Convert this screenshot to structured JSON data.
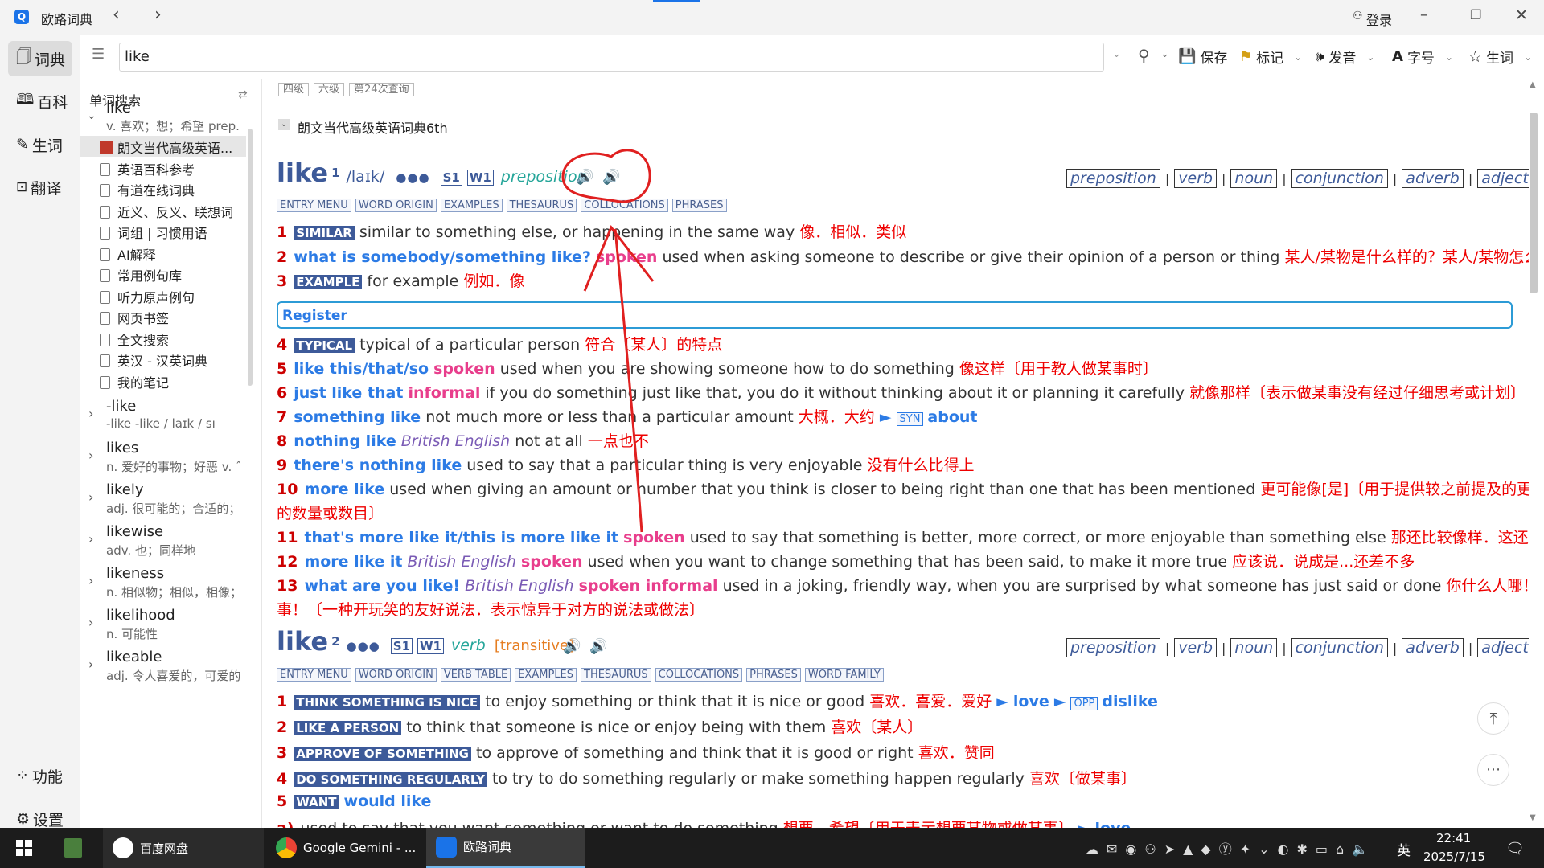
{
  "app": {
    "title": "欧路词典",
    "login": "登录"
  },
  "nav": [
    {
      "label": "词典"
    },
    {
      "label": "百科"
    },
    {
      "label": "生词"
    },
    {
      "label": "翻译"
    }
  ],
  "nav_bottom": [
    {
      "label": "功能"
    },
    {
      "label": "设置"
    }
  ],
  "search": {
    "value": "like"
  },
  "toolbar": {
    "save": "保存",
    "mark": "标记",
    "speak": "发音",
    "font": "字号",
    "vocab": "生词"
  },
  "panel": {
    "title": "单词搜索"
  },
  "wordlist": {
    "first": {
      "word": "like",
      "def": "v. 喜欢；想；希望 prep."
    },
    "dicts": [
      "朗文当代高级英语...",
      "英语百科参考",
      "有道在线词典",
      "近义、反义、联想词",
      "词组 | 习惯用语",
      "AI解释",
      "常用例句库",
      "听力原声例句",
      "网页书签",
      "全文搜索",
      "英汉 - 汉英词典",
      "我的笔记"
    ],
    "words": [
      {
        "word": "-like",
        "def": "-like -like / laɪk / sı"
      },
      {
        "word": "likes",
        "def": "n. 爱好的事物；好恶 v. ˆ"
      },
      {
        "word": "likely",
        "def": "adj. 很可能的；合适的；"
      },
      {
        "word": "likewise",
        "def": "adv. 也；同样地"
      },
      {
        "word": "likeness",
        "def": "n. 相似物；相似，相像；"
      },
      {
        "word": "likelihood",
        "def": "n. 可能性"
      },
      {
        "word": "likeable",
        "def": "adj. 令人喜爱的，可爱的"
      }
    ]
  },
  "entry": {
    "levels": [
      "四级",
      "六级",
      "第24次查询"
    ],
    "dict_name": "朗文当代高级英语词典6th",
    "hw1": {
      "word": "like",
      "sup": "1",
      "pron": "/laɪk/",
      "dots": "●●●",
      "s": "S1",
      "w": "W1",
      "pos": "preposition"
    },
    "pos_buttons": [
      "preposition",
      "verb",
      "noun",
      "conjunction",
      "adverb",
      "adjective"
    ],
    "sections1": [
      "ENTRY MENU",
      "WORD ORIGIN",
      "EXAMPLES",
      "THESAURUS",
      "COLLOCATIONS",
      "PHRASES"
    ],
    "senses1": [
      {
        "n": "1",
        "tag": "SIMILAR",
        "text": "similar to something else, or happening in the same way",
        "cn": "像．相似．类似"
      },
      {
        "n": "2",
        "kw": "what is somebody/something like?",
        "spk": "spoken",
        "text": "used when asking someone to describe or give their opinion of a person or thing",
        "cn": "某人/某物是什么样的？某人/某物怎么样？"
      },
      {
        "n": "3",
        "tag": "EXAMPLE",
        "text": "for example",
        "cn": "例如．像"
      }
    ],
    "register": "Register",
    "senses2": [
      {
        "n": "4",
        "tag": "TYPICAL",
        "text": "typical of a particular person",
        "cn": "符合〔某人〕的特点"
      },
      {
        "n": "5",
        "kw": "like this/that/so",
        "spk": "spoken",
        "text": "used when you are showing someone how to do something",
        "cn": "像这样〔用于教人做某事时〕"
      },
      {
        "n": "6",
        "kw": "just like that",
        "spk": "informal",
        "text": "if you do something just like that, you do it without thinking about it or planning it carefully",
        "cn": "就像那样〔表示做某事没有经过仔细思考或计划〕"
      },
      {
        "n": "7",
        "kw": "something like",
        "text": "not much more or less than a particular amount",
        "cn": "大概．大约",
        "syn": "SYN",
        "ref": "about"
      },
      {
        "n": "8",
        "kw": "nothing like",
        "var": "British English",
        "text": "not at all",
        "cn": "一点也不"
      },
      {
        "n": "9",
        "kw": "there's nothing like",
        "text": "used to say that a particular thing is very enjoyable",
        "cn": "没有什么比得上"
      },
      {
        "n": "10",
        "kw": "more like",
        "text": "used when giving an amount or number that you think is closer to being right than one that has been mentioned",
        "cn": "更可能像[是]〔用于提供较之前提及的更准确",
        "cn2": "的数量或数目〕"
      },
      {
        "n": "11",
        "kw": "that's more like it/this is more like it",
        "spk": "spoken",
        "text": "used to say that something is better, more correct, or more enjoyable than something else",
        "cn": "那还比较像样．这还差不多"
      },
      {
        "n": "12",
        "kw": "more like it",
        "var": "British English",
        "spk": "spoken",
        "text": "used when you want to change something that has been said, to make it more true",
        "cn": "应该说．说成是...还差不多"
      },
      {
        "n": "13",
        "kw": "what are you like!",
        "var": "British English",
        "spk": "spoken informal",
        "text": "used in a joking, friendly way, when you are surprised by what someone has just said or done",
        "cn": "你什么人哪！你怎么回",
        "cn2": "事！〔一种开玩笑的友好说法．表示惊异于对方的说法或做法〕"
      }
    ],
    "hw2": {
      "word": "like",
      "sup": "2",
      "dots": "●●●",
      "s": "S1",
      "w": "W1",
      "pos": "verb",
      "gram": "[transitive]"
    },
    "sections2": [
      "ENTRY MENU",
      "WORD ORIGIN",
      "VERB TABLE",
      "EXAMPLES",
      "THESAURUS",
      "COLLOCATIONS",
      "PHRASES",
      "WORD FAMILY"
    ],
    "senses3": [
      {
        "n": "1",
        "tag": "THINK SOMETHING IS NICE",
        "text": "to enjoy something or think that it is nice or good",
        "cn": "喜欢．喜爱．爱好",
        "ref": "love",
        "opp": "OPP",
        "ref2": "dislike"
      },
      {
        "n": "2",
        "tag": "LIKE A PERSON",
        "text": "to think that someone is nice or enjoy being with them",
        "cn": "喜欢〔某人〕"
      },
      {
        "n": "3",
        "tag": "APPROVE OF SOMETHING",
        "text": "to approve of something and think that it is good or right",
        "cn": "喜欢．赞同"
      },
      {
        "n": "4",
        "tag": "DO SOMETHING REGULARLY",
        "text": "to try to do something regularly or make something happen regularly",
        "cn": "喜欢〔做某事〕"
      },
      {
        "n": "5",
        "tag": "WANT",
        "kw": "would like"
      }
    ],
    "partial": {
      "n": "a)",
      "text": "used to say that you want something or want to do something",
      "cn": "想要．希望〔用于表示想要某物或做某事〕",
      "ref": "love"
    }
  },
  "taskbar": {
    "items": [
      "百度网盘",
      "Google Gemini - ...",
      "欧路词典"
    ],
    "ime": "英",
    "time": "22:41",
    "date": "2025/7/15"
  },
  "colors": {
    "accent": "#3d5a99",
    "chinese": "#e00",
    "keyword": "#2c7be5",
    "spoken": "#e83e8c",
    "annotation": "#e02020"
  }
}
